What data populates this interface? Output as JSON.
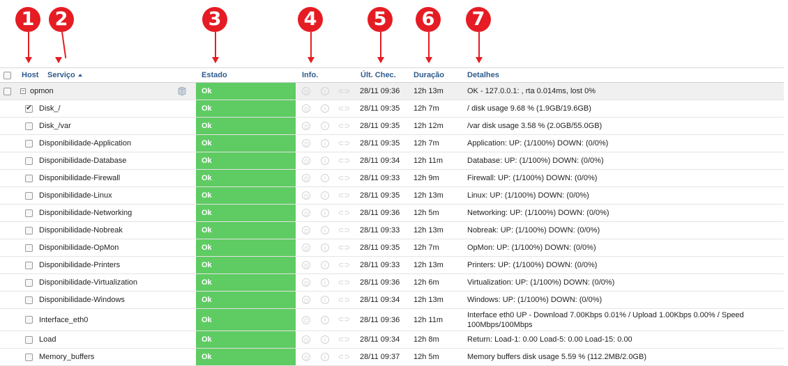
{
  "markers": [
    "1",
    "2",
    "3",
    "4",
    "5",
    "6",
    "7"
  ],
  "columns": {
    "host": "Host",
    "service": "Serviço",
    "status": "Estado",
    "info": "Info.",
    "last_check": "Últ. Chec.",
    "duration": "Duração",
    "details": "Detalhes"
  },
  "host_row": {
    "name": "opmon",
    "status": "Ok",
    "last_check": "28/11 09:36",
    "duration": "12h 13m",
    "details": "OK - 127.0.0.1: , rta 0.014ms, lost 0%"
  },
  "services": [
    {
      "name": "Disk_/",
      "checked": true,
      "status": "Ok",
      "last_check": "28/11 09:35",
      "duration": "12h 7m",
      "details": "/ disk usage 9.68 % (1.9GB/19.6GB)"
    },
    {
      "name": "Disk_/var",
      "checked": false,
      "status": "Ok",
      "last_check": "28/11 09:35",
      "duration": "12h 12m",
      "details": "/var disk usage 3.58 % (2.0GB/55.0GB)"
    },
    {
      "name": "Disponibilidade-Application",
      "checked": false,
      "status": "Ok",
      "last_check": "28/11 09:35",
      "duration": "12h 7m",
      "details": "Application: UP: (1/100%) DOWN: (0/0%)"
    },
    {
      "name": "Disponibilidade-Database",
      "checked": false,
      "status": "Ok",
      "last_check": "28/11 09:34",
      "duration": "12h 11m",
      "details": "Database: UP: (1/100%) DOWN: (0/0%)"
    },
    {
      "name": "Disponibilidade-Firewall",
      "checked": false,
      "status": "Ok",
      "last_check": "28/11 09:33",
      "duration": "12h 9m",
      "details": "Firewall: UP: (1/100%) DOWN: (0/0%)"
    },
    {
      "name": "Disponibilidade-Linux",
      "checked": false,
      "status": "Ok",
      "last_check": "28/11 09:35",
      "duration": "12h 13m",
      "details": "Linux: UP: (1/100%) DOWN: (0/0%)"
    },
    {
      "name": "Disponibilidade-Networking",
      "checked": false,
      "status": "Ok",
      "last_check": "28/11 09:36",
      "duration": "12h 5m",
      "details": "Networking: UP: (1/100%) DOWN: (0/0%)"
    },
    {
      "name": "Disponibilidade-Nobreak",
      "checked": false,
      "status": "Ok",
      "last_check": "28/11 09:33",
      "duration": "12h 13m",
      "details": "Nobreak: UP: (1/100%) DOWN: (0/0%)"
    },
    {
      "name": "Disponibilidade-OpMon",
      "checked": false,
      "status": "Ok",
      "last_check": "28/11 09:35",
      "duration": "12h 7m",
      "details": "OpMon: UP: (1/100%) DOWN: (0/0%)"
    },
    {
      "name": "Disponibilidade-Printers",
      "checked": false,
      "status": "Ok",
      "last_check": "28/11 09:33",
      "duration": "12h 13m",
      "details": "Printers: UP: (1/100%) DOWN: (0/0%)"
    },
    {
      "name": "Disponibilidade-Virtualization",
      "checked": false,
      "status": "Ok",
      "last_check": "28/11 09:36",
      "duration": "12h 6m",
      "details": "Virtualization: UP: (1/100%) DOWN: (0/0%)"
    },
    {
      "name": "Disponibilidade-Windows",
      "checked": false,
      "status": "Ok",
      "last_check": "28/11 09:34",
      "duration": "12h 13m",
      "details": "Windows: UP: (1/100%) DOWN: (0/0%)"
    },
    {
      "name": "Interface_eth0",
      "checked": false,
      "status": "Ok",
      "last_check": "28/11 09:36",
      "duration": "12h 11m",
      "details": "Interface eth0 UP - Download 7.00Kbps 0.01% / Upload 1.00Kbps 0.00% / Speed 100Mbps/100Mbps"
    },
    {
      "name": "Load",
      "checked": false,
      "status": "Ok",
      "last_check": "28/11 09:34",
      "duration": "12h 8m",
      "details": "Return: Load-1: 0.00 Load-5: 0.00 Load-15: 0.00"
    },
    {
      "name": "Memory_buffers",
      "checked": false,
      "status": "Ok",
      "last_check": "28/11 09:37",
      "duration": "12h 5m",
      "details": "Memory buffers disk usage 5.59 % (112.2MB/2.0GB)"
    }
  ],
  "icons": {
    "clock": "clock-icon",
    "info": "info-icon",
    "link": "link-icon",
    "server": "server-icon"
  },
  "colors": {
    "ok_status": "#5fcb63",
    "header_text": "#2e5b8c",
    "marker": "#e51c23"
  }
}
